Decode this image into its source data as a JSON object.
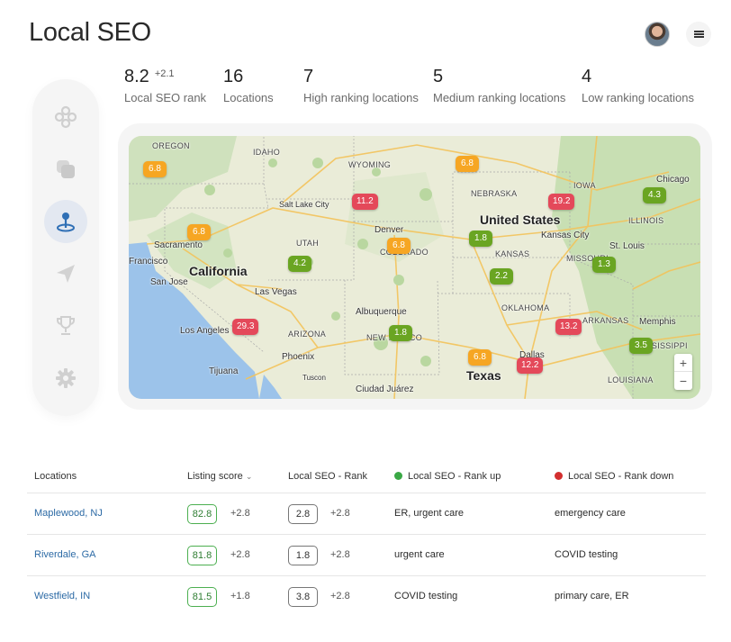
{
  "header": {
    "title": "Local SEO"
  },
  "stats": [
    {
      "value": "8.2",
      "delta": "+2.1",
      "label": "Local SEO rank"
    },
    {
      "value": "16",
      "delta": "",
      "label": "Locations"
    },
    {
      "value": "7",
      "delta": "",
      "label": "High ranking locations"
    },
    {
      "value": "5",
      "delta": "",
      "label": "Medium ranking locations"
    },
    {
      "value": "4",
      "delta": "",
      "label": "Low ranking locations"
    }
  ],
  "sidebar": {
    "items": [
      {
        "icon": "dashboard-icon"
      },
      {
        "icon": "layers-icon"
      },
      {
        "icon": "location-pin-icon",
        "active": true
      },
      {
        "icon": "send-icon"
      },
      {
        "icon": "trophy-icon"
      },
      {
        "icon": "settings-icon"
      }
    ]
  },
  "map": {
    "labels": {
      "oregon": "OREGON",
      "idaho": "IDAHO",
      "wyoming": "WYOMING",
      "nebraska": "NEBRASKA",
      "iowa": "IOWA",
      "chicago": "Chicago",
      "illinois": "ILLINOIS",
      "salt_lake": "Salt Lake City",
      "denver": "Denver",
      "colorado": "COLORADO",
      "utah": "UTAH",
      "united_states": "United States",
      "kansas_city": "Kansas City",
      "kansas": "KANSAS",
      "st_louis": "St. Louis",
      "missouri": "MISSOURI",
      "sacramento": "Sacramento",
      "san_francisco": "Francisco",
      "california": "California",
      "san_jose": "San Jose",
      "las_vegas": "Las Vegas",
      "oklahoma": "OKLAHOMA",
      "albuquerque": "Albuquerque",
      "arkansas": "ARKANSAS",
      "memphis": "Memphis",
      "los_angeles": "Los Angeles",
      "arizona": "ARIZONA",
      "new_mexico": "NEW MEXICO",
      "mississippi": "MISSISSIPPI",
      "phoenix": "Phoenix",
      "dallas": "Dallas",
      "tijuana": "Tijuana",
      "tucson": "Tuscon",
      "texas": "Texas",
      "ciudad_juarez": "Ciudad Juárez",
      "louisiana": "LOUISIANA"
    },
    "pins": [
      {
        "value": "6.8",
        "color": "#f6a623"
      },
      {
        "value": "6.8",
        "color": "#f6a623"
      },
      {
        "value": "11.2",
        "color": "#e4495a"
      },
      {
        "value": "19.2",
        "color": "#e4495a"
      },
      {
        "value": "4.3",
        "color": "#6aa522"
      },
      {
        "value": "6.8",
        "color": "#f6a623"
      },
      {
        "value": "6.8",
        "color": "#f6a623"
      },
      {
        "value": "1.8",
        "color": "#6aa522"
      },
      {
        "value": "4.2",
        "color": "#6aa522"
      },
      {
        "value": "1.3",
        "color": "#6aa522"
      },
      {
        "value": "2.2",
        "color": "#6aa522"
      },
      {
        "value": "29.3",
        "color": "#e4495a"
      },
      {
        "value": "13.2",
        "color": "#e4495a"
      },
      {
        "value": "1.8",
        "color": "#6aa522"
      },
      {
        "value": "3.5",
        "color": "#6aa522"
      },
      {
        "value": "6.8",
        "color": "#f6a623"
      },
      {
        "value": "12.2",
        "color": "#e4495a"
      }
    ],
    "zoom_in": "+",
    "zoom_out": "−"
  },
  "table": {
    "headers": {
      "locations": "Locations",
      "listing_score": "Listing score",
      "sort_indicator": "⌄",
      "seo_rank": "Local SEO - Rank",
      "rank_up": "Local SEO - Rank up",
      "rank_down": "Local SEO - Rank down"
    },
    "colors": {
      "up": "#3aa845",
      "down": "#d32f2f"
    },
    "rows": [
      {
        "location": "Maplewood, NJ",
        "score": "82.8",
        "score_delta": "+2.8",
        "rank": "2.8",
        "rank_delta": "+2.8",
        "up": "ER, urgent care",
        "down": "emergency care"
      },
      {
        "location": "Riverdale, GA",
        "score": "81.8",
        "score_delta": "+2.8",
        "rank": "1.8",
        "rank_delta": "+2.8",
        "up": "urgent care",
        "down": "COVID testing"
      },
      {
        "location": "Westfield, IN",
        "score": "81.5",
        "score_delta": "+1.8",
        "rank": "3.8",
        "rank_delta": "+2.8",
        "up": "COVID testing",
        "down": "primary care, ER"
      }
    ]
  }
}
